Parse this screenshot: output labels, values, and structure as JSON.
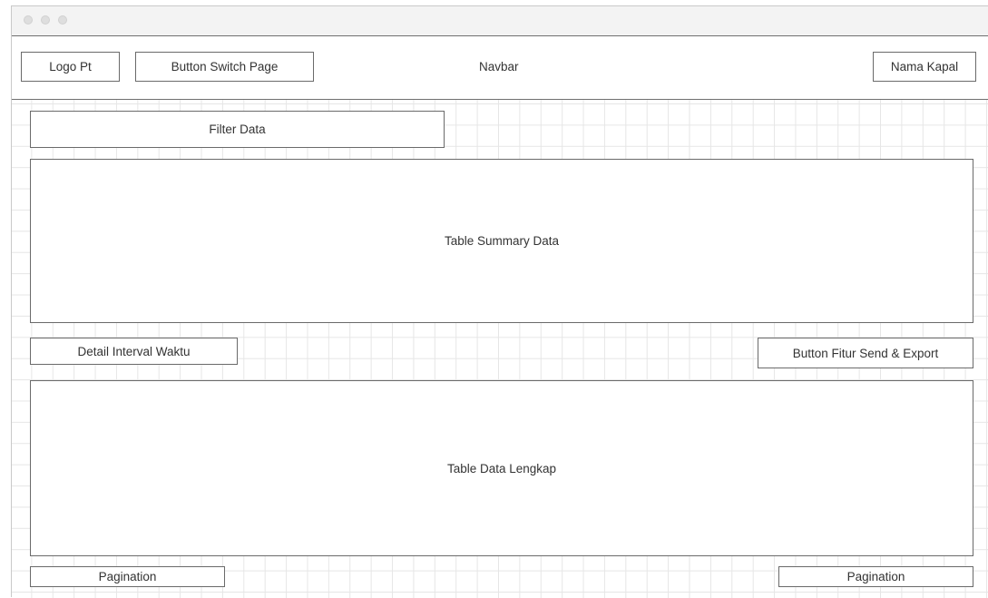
{
  "navbar": {
    "logo_label": "Logo Pt",
    "switch_page_label": "Button Switch Page",
    "title": "Navbar",
    "ship_name_label": "Nama Kapal"
  },
  "main": {
    "filter_label": "Filter Data",
    "summary_table_label": "Table Summary Data",
    "interval_label": "Detail Interval Waktu",
    "send_export_label": "Button Fitur Send & Export",
    "full_table_label": "Table Data Lengkap",
    "pagination_left_label": "Pagination",
    "pagination_right_label": "Pagination"
  }
}
